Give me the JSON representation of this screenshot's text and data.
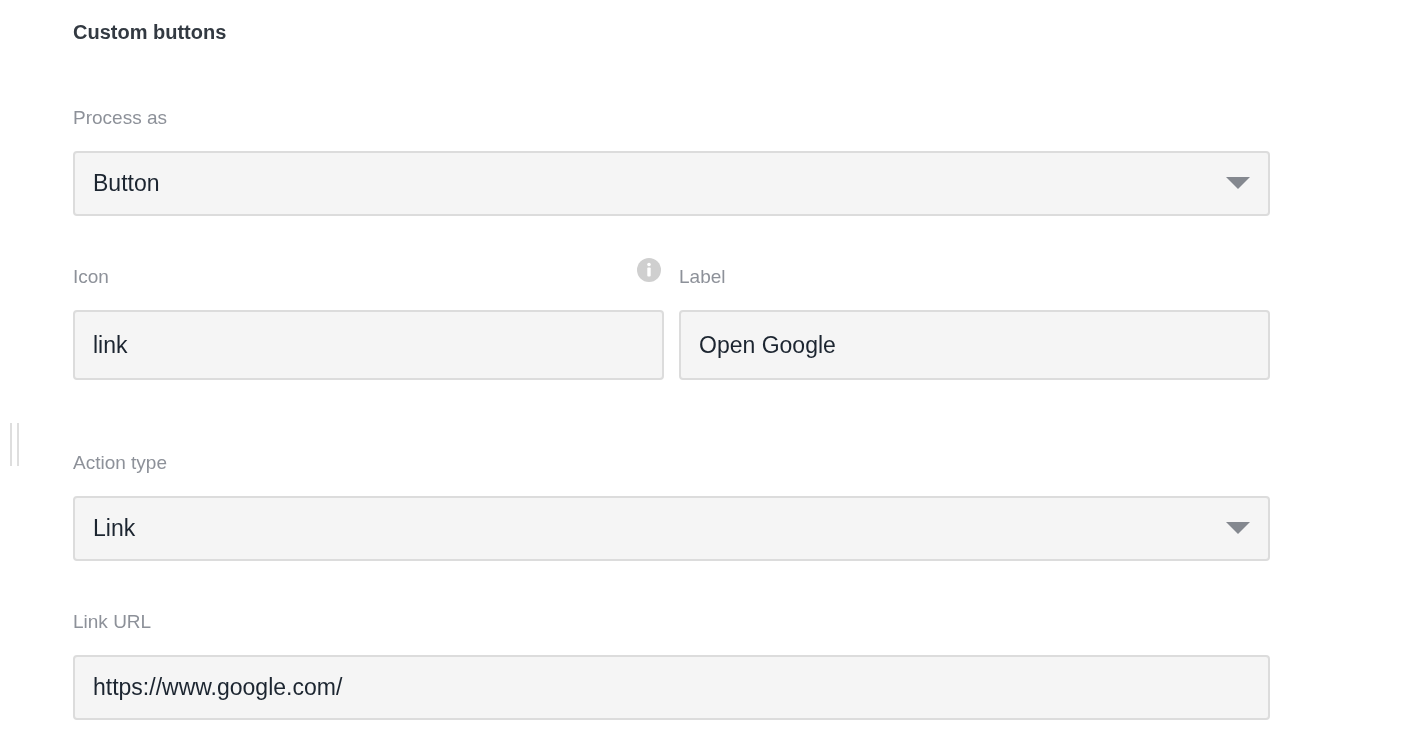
{
  "heading": "Custom buttons",
  "fields": [
    {
      "kind": "select",
      "label": "Process as",
      "value": "Button"
    },
    {
      "kind": "pair",
      "items": [
        {
          "label": "Icon",
          "value": "link",
          "info": true
        },
        {
          "label": "Label",
          "value": "Open Google",
          "info": false
        }
      ]
    },
    {
      "kind": "select",
      "label": "Action type",
      "value": "Link"
    },
    {
      "kind": "text",
      "label": "Link URL",
      "value": "https://www.google.com/"
    }
  ]
}
